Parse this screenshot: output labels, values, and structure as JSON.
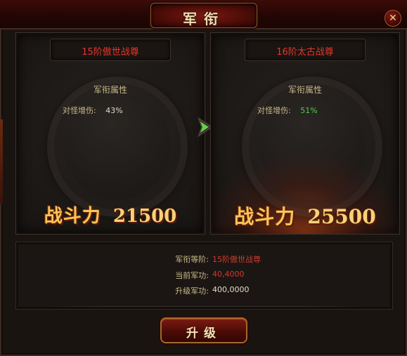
{
  "window": {
    "title": "军衔",
    "close_symbol": "✕"
  },
  "left_card": {
    "rank_name": "15阶傲世战尊",
    "attr_title": "军衔属性",
    "attr_label": "对怪增伤:",
    "attr_value": "43%",
    "power_label": "战斗力",
    "power_value": "21500"
  },
  "right_card": {
    "rank_name": "16阶太古战尊",
    "attr_title": "军衔属性",
    "attr_label": "对怪增伤:",
    "attr_value": "51%",
    "power_label": "战斗力",
    "power_value": "25500"
  },
  "info": {
    "rows": [
      {
        "label": "军衔等阶:",
        "value": "15阶傲世战尊"
      },
      {
        "label": "当前军功:",
        "value": "40,4000"
      },
      {
        "label": "升级军功:",
        "value": "400,0000"
      }
    ]
  },
  "upgrade_button": {
    "label": "升级"
  },
  "colors": {
    "rank_red": "#e2382a",
    "increase_green": "#4fd04a",
    "gold": "#f6c658"
  },
  "icons": {
    "arrow": "green-right-arrow-icon",
    "close": "close-icon"
  }
}
